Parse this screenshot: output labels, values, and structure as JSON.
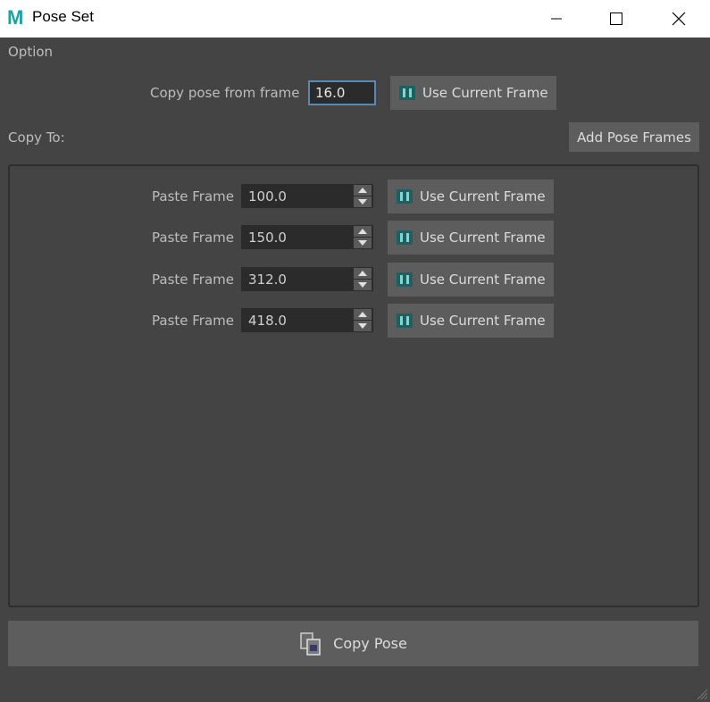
{
  "window": {
    "app_icon_letter": "M",
    "title": "Pose Set"
  },
  "option": {
    "label": "Option",
    "copy_from_label": "Copy pose from frame",
    "copy_from_value": "16.0",
    "use_current_label": "Use Current Frame"
  },
  "copy_to": {
    "label": "Copy To:",
    "add_button_label": "Add Pose Frames",
    "rows": [
      {
        "label": "Paste Frame",
        "value": "100.0",
        "button": "Use Current Frame"
      },
      {
        "label": "Paste Frame",
        "value": "150.0",
        "button": "Use Current Frame"
      },
      {
        "label": "Paste Frame",
        "value": "312.0",
        "button": "Use Current Frame"
      },
      {
        "label": "Paste Frame",
        "value": "418.0",
        "button": "Use Current Frame"
      }
    ]
  },
  "footer": {
    "copy_pose_label": "Copy Pose"
  },
  "colors": {
    "background": "#444444",
    "button": "#5d5d5d",
    "field": "#2b2b2b",
    "focus_border": "#5b87b5",
    "icon_teal": "#2aa6a0"
  }
}
